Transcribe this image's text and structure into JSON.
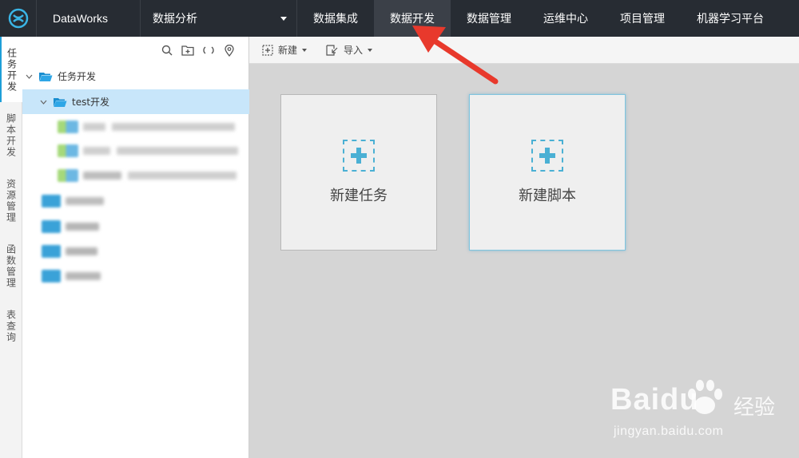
{
  "header": {
    "brand": "DataWorks",
    "module": "数据分析",
    "nav": [
      {
        "label": "数据集成",
        "active": false
      },
      {
        "label": "数据开发",
        "active": true
      },
      {
        "label": "数据管理",
        "active": false
      },
      {
        "label": "运维中心",
        "active": false
      },
      {
        "label": "项目管理",
        "active": false
      },
      {
        "label": "机器学习平台",
        "active": false
      }
    ]
  },
  "sidebar": {
    "tabs": [
      "任务开发",
      "脚本开发",
      "资源管理",
      "函数管理",
      "表查询"
    ],
    "active_tab": "任务开发"
  },
  "tree": {
    "root": "任务开发",
    "child": "test开发"
  },
  "toolbar": {
    "new_label": "新建",
    "import_label": "导入"
  },
  "cards": {
    "new_task": "新建任务",
    "new_script": "新建脚本"
  },
  "watermark": {
    "brand": "Baidu",
    "suffix": "经验",
    "url": "jingyan.baidu.com"
  },
  "colors": {
    "topbar": "#272c33",
    "accent": "#1e9fd8",
    "selected_row": "#c8e6fa",
    "annotation_arrow": "#e8392c"
  }
}
